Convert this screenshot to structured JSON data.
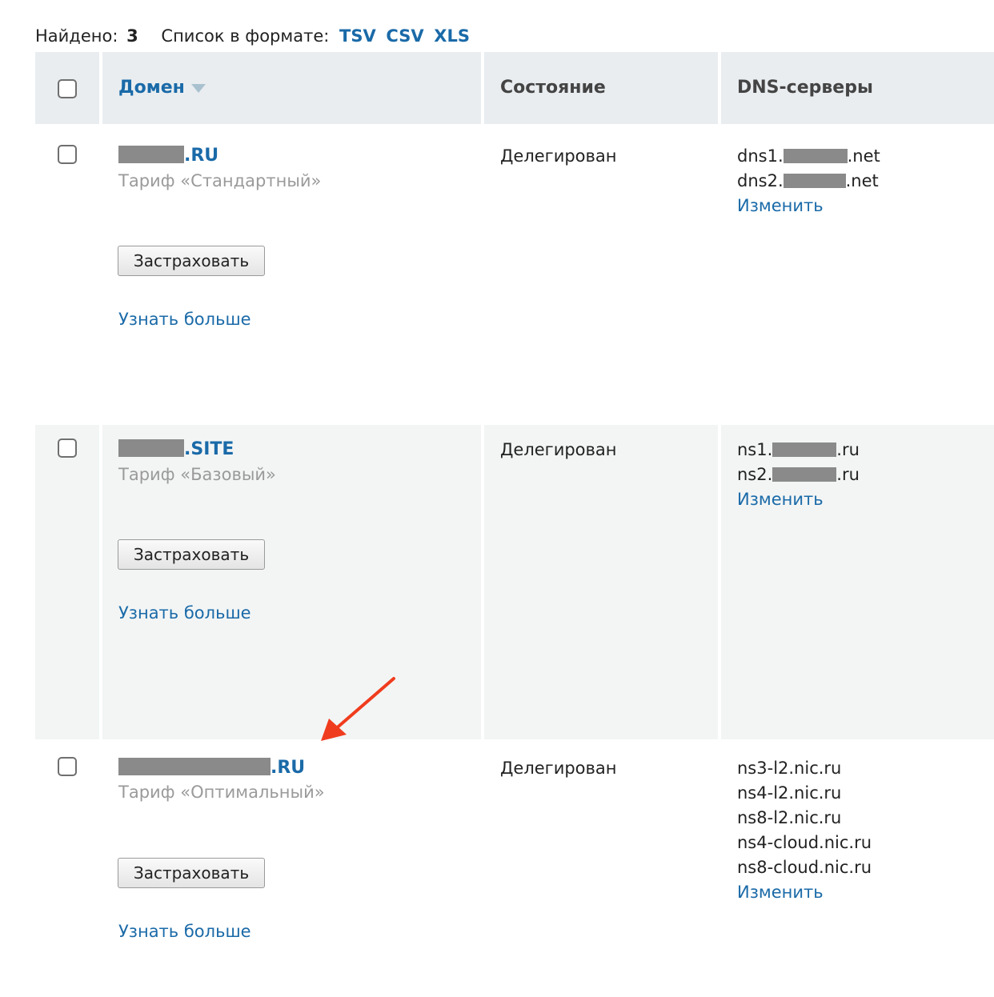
{
  "summary": {
    "found_label": "Найдено:",
    "found_count": "3",
    "format_label": "Список в формате:",
    "formats": [
      "TSV",
      "CSV",
      "XLS"
    ]
  },
  "table": {
    "columns": {
      "domain": "Домен",
      "state": "Состояние",
      "dns": "DNS-серверы"
    },
    "rows": [
      {
        "domain_suffix": ".RU",
        "tariff": "Тариф «Стандартный»",
        "insure_label": "Застраховать",
        "more_label": "Узнать больше",
        "state": "Делегирован",
        "dns": [
          {
            "prefix": "dns1.",
            "suffix": ".net"
          },
          {
            "prefix": "dns2.",
            "suffix": ".net"
          }
        ],
        "change_label": "Изменить"
      },
      {
        "domain_suffix": ".SITE",
        "tariff": "Тариф «Базовый»",
        "insure_label": "Застраховать",
        "more_label": "Узнать больше",
        "state": "Делегирован",
        "dns": [
          {
            "prefix": "ns1.",
            "suffix": ".ru"
          },
          {
            "prefix": "ns2.",
            "suffix": ".ru"
          }
        ],
        "change_label": "Изменить"
      },
      {
        "domain_suffix": ".RU",
        "tariff": "Тариф «Оптимальный»",
        "insure_label": "Застраховать",
        "more_label": "Узнать больше",
        "state": "Делегирован",
        "dns": [
          "ns3-l2.nic.ru",
          "ns4-l2.nic.ru",
          "ns8-l2.nic.ru",
          "ns4-cloud.nic.ru",
          "ns8-cloud.nic.ru"
        ],
        "change_label": "Изменить"
      }
    ]
  },
  "colors": {
    "link": "#1a6aa8",
    "header_bg": "#e9edf0",
    "alt_row_bg": "#f3f5f5",
    "annotation_arrow": "#f03c1e"
  }
}
